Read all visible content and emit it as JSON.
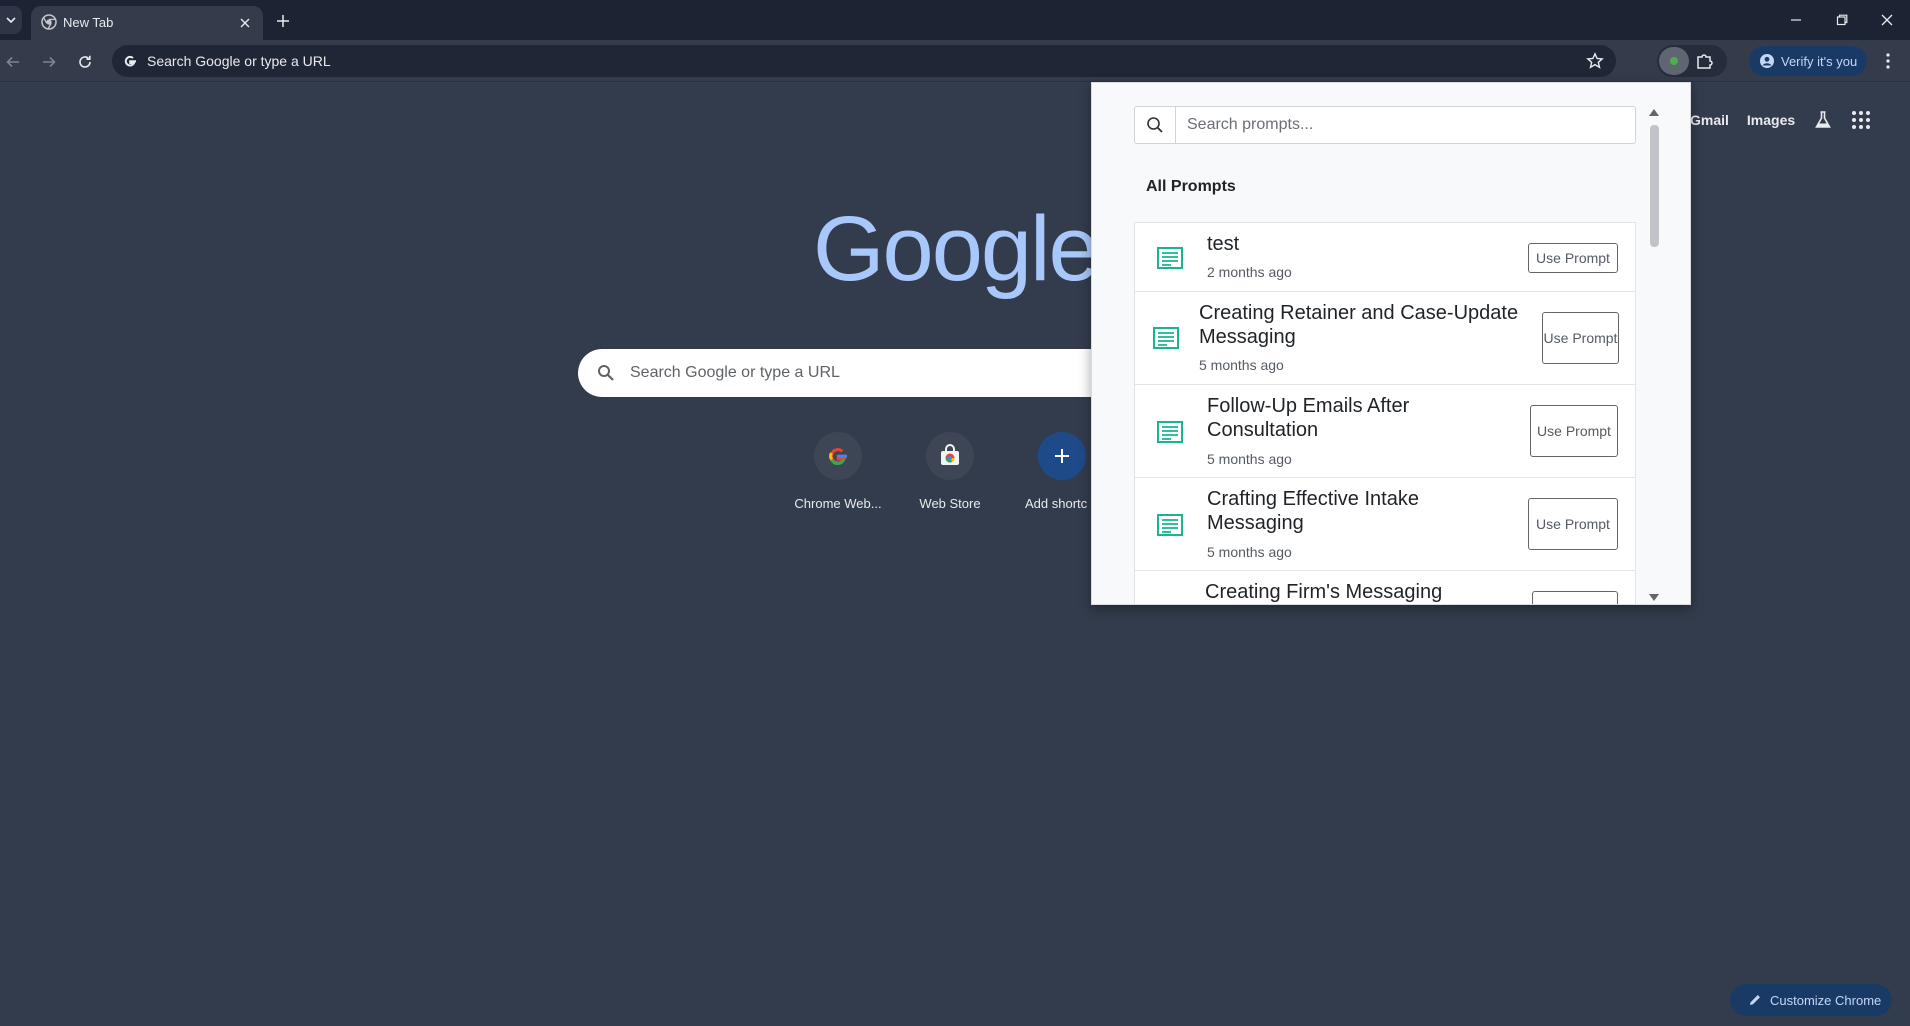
{
  "browser": {
    "tab_title": "New Tab",
    "omnibox_placeholder": "Search Google or type a URL",
    "verify_label": "Verify it's you"
  },
  "ntp": {
    "top_links": [
      "Gmail",
      "Images"
    ],
    "logo": "Google",
    "search_placeholder": "Search Google or type a URL",
    "shortcuts": [
      {
        "label": "Chrome Web...",
        "icon": "google-g-icon"
      },
      {
        "label": "Web Store",
        "icon": "web-store-icon"
      },
      {
        "label": "Add shortc",
        "icon": "plus-icon"
      }
    ],
    "customize_label": "Customize Chrome"
  },
  "prompts_popup": {
    "search_placeholder": "Search prompts...",
    "heading": "All Prompts",
    "button_label": "Use Prompt",
    "items": [
      {
        "title": "test",
        "date": "2 months ago"
      },
      {
        "title": "Creating Retainer and Case-Update Messaging",
        "date": "5 months ago"
      },
      {
        "title": "Follow-Up Emails After Consultation",
        "date": "5 months ago"
      },
      {
        "title": "Crafting Effective Intake Messaging",
        "date": "5 months ago"
      },
      {
        "title": "Creating Firm's Messaging",
        "date": ""
      }
    ]
  },
  "colors": {
    "page_bg": "#333c4d",
    "tabstrip_bg": "#1c2434",
    "logo_blue": "#a8c7fa",
    "accent_button": "#1a3a66",
    "prompt_icon_teal": "#1ab394"
  }
}
